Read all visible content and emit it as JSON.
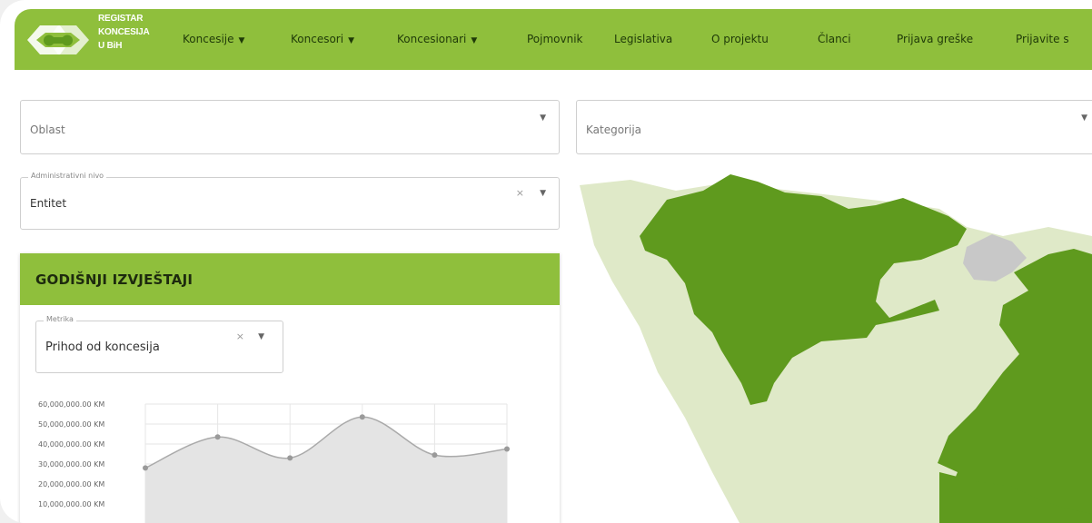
{
  "brand": {
    "line1": "REGISTAR",
    "line2": "KONCESIJA",
    "line3": "U BiH",
    "color_primary": "#8fbf3c",
    "color_dark": "#5f9a1e",
    "color_light": "#dfe9c8"
  },
  "nav": {
    "items": [
      {
        "label": "Koncesije",
        "dropdown": true
      },
      {
        "label": "Koncesori",
        "dropdown": true
      },
      {
        "label": "Koncesionari",
        "dropdown": true
      },
      {
        "label": "Pojmovnik",
        "dropdown": false
      },
      {
        "label": "Legislativa",
        "dropdown": false
      },
      {
        "label": "O projektu",
        "dropdown": false
      },
      {
        "label": "Članci",
        "dropdown": false
      },
      {
        "label": "Prijava greške",
        "dropdown": false
      },
      {
        "label": "Prijavite s",
        "dropdown": false
      }
    ],
    "caret": "▼"
  },
  "filters": {
    "oblast": {
      "placeholder": "Oblast"
    },
    "kategorija": {
      "placeholder": "Kategorija"
    },
    "admin": {
      "legend": "Administrativni nivo",
      "value": "Entitet"
    }
  },
  "panel": {
    "title": "GODIŠNJI IZVJEŠTAJI",
    "metric": {
      "legend": "Metrika",
      "value": "Prihod od koncesija"
    }
  },
  "icons": {
    "clear": "×",
    "arrow": "▼"
  },
  "chart_data": {
    "type": "area",
    "yticks": [
      "60,000,000.00 KM",
      "50,000,000.00 KM",
      "40,000,000.00 KM",
      "30,000,000.00 KM",
      "20,000,000.00 KM",
      "10,000,000.00 KM"
    ],
    "ylim": [
      0,
      60000000
    ],
    "values": [
      28000000,
      43500000,
      33000000,
      53500000,
      34500000,
      37500000
    ],
    "grid": true,
    "line_color": "#aaaaaa",
    "fill_color": "#e4e4e4"
  }
}
